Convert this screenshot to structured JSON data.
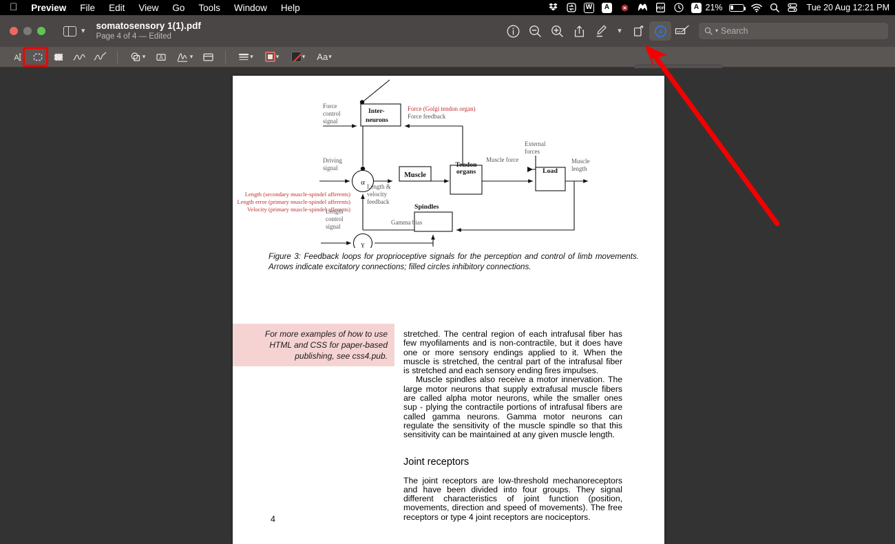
{
  "menubar": {
    "apple_icon": "apple-logo",
    "items": [
      {
        "label": "Preview",
        "bold": true
      },
      {
        "label": "File",
        "bold": false
      },
      {
        "label": "Edit",
        "bold": false
      },
      {
        "label": "View",
        "bold": false
      },
      {
        "label": "Go",
        "bold": false
      },
      {
        "label": "Tools",
        "bold": false
      },
      {
        "label": "Window",
        "bold": false
      },
      {
        "label": "Help",
        "bold": false
      }
    ],
    "status_icons": [
      "dropbox-icon",
      "sync-arrow-icon",
      "word-w-icon",
      "adobe-a-icon",
      "record-dot-icon",
      "malwarebytes-m-icon",
      "pdf-icon",
      "clock-history-icon",
      "text-input-a-icon"
    ],
    "battery_percent": "21%",
    "wifi_icon": "wifi-icon",
    "spotlight_icon": "search-icon",
    "controlcenter_icon": "control-center-icon",
    "clock": "Tue 20 Aug  12:21 PM"
  },
  "window": {
    "title": "somatosensory 1(1).pdf",
    "subtitle": "Page 4 of 4 — Edited",
    "traffic_lights": [
      "close-button",
      "minimize-button",
      "zoom-button"
    ],
    "sidebar_toggle": "sidebar-toggle-button",
    "toolbar": [
      {
        "name": "info-button",
        "icon": "info-circle-icon"
      },
      {
        "name": "zoom-out-button",
        "icon": "magnifier-minus-icon"
      },
      {
        "name": "zoom-in-button",
        "icon": "magnifier-plus-icon"
      },
      {
        "name": "share-button",
        "icon": "share-up-arrow-icon"
      },
      {
        "name": "markup-button",
        "icon": "markup-pen-icon"
      },
      {
        "name": "markup-dropdown",
        "icon": "chevron-down-icon"
      },
      {
        "name": "rotate-button",
        "icon": "rotate-page-icon"
      },
      {
        "name": "annotate-button",
        "icon": "circle-a-icon",
        "active": true
      },
      {
        "name": "signature-button",
        "icon": "signature-pad-icon"
      }
    ],
    "search_placeholder": "Search"
  },
  "markup_toolbar": {
    "tools": [
      {
        "name": "text-selection-tool",
        "icon": "text-cursor-icon",
        "selected": false
      },
      {
        "name": "rectangular-selection-tool",
        "icon": "dashed-rectangle-icon",
        "selected": true
      },
      {
        "name": "instant-alpha-tool",
        "icon": "filled-dashed-square-icon",
        "selected": false
      },
      {
        "name": "sketch-tool",
        "icon": "squiggle-line-icon",
        "selected": false
      },
      {
        "name": "draw-tool",
        "icon": "pen-squiggle-icon",
        "selected": false
      },
      {
        "name": "shapes-tool",
        "icon": "shapes-icon",
        "selected": false,
        "has_dropdown": true
      },
      {
        "name": "text-tool",
        "icon": "boxed-a-icon",
        "selected": false
      },
      {
        "name": "sign-tool",
        "icon": "signature-icon",
        "selected": false,
        "has_dropdown": true
      },
      {
        "name": "note-tool",
        "icon": "sticky-note-icon",
        "selected": false
      }
    ],
    "styles": [
      {
        "name": "border-style-dropdown",
        "icon": "line-weight-icon"
      },
      {
        "name": "border-color-dropdown",
        "icon": "red-square-swatch-icon"
      },
      {
        "name": "fill-color-dropdown",
        "icon": "no-fill-swatch-icon"
      },
      {
        "name": "font-style-dropdown",
        "label": "Aa"
      }
    ]
  },
  "annotation": {
    "highlight_box": "red-rectangle-highlight",
    "arrow": "red-arrow-pointer",
    "arrow_color": "#f40000"
  },
  "document": {
    "page_number": "4",
    "figure": {
      "caption": "Figure 3:  Feedback loops for proprioceptive signals for the perception and control of limb movements. Arrows indicate excitatory connections; filled circles inhibitory connections.",
      "boxes": [
        {
          "label": "Inter-neurons",
          "line1": "Inter-",
          "line2": "neurons"
        },
        {
          "label": "Muscle"
        },
        {
          "label": "Tendon organs",
          "line1": "Tendon",
          "line2": "organs"
        },
        {
          "label": "Load"
        },
        {
          "label": "Spindles"
        }
      ],
      "nodes": [
        {
          "label": "α",
          "type": "summing-junction"
        },
        {
          "label": "γ",
          "type": "summing-junction"
        }
      ],
      "gray_labels": [
        "Force control signal",
        "Force feedback",
        "Driving signal",
        "External forces",
        "Muscle force",
        "Muscle length",
        "Length & velocity feedback",
        "Length control signal",
        "Gamma bias",
        "Spindles"
      ],
      "red_labels": [
        "Force (Golgi tendon organ)",
        "Length (secondary muscle-spindel afferents)",
        "Length error (primary muscle-spindel afferents)",
        "Velocity (primary muscle-spindel afferents)"
      ],
      "red_label_color": "#c32d2d"
    },
    "callout": {
      "text": "For more examples of how to use HTML and CSS for paper-based publishing, see css4.pub.",
      "bg_color": "#f6d3d3"
    },
    "body": {
      "paragraphs": [
        "stretched. The central region of each intrafusal fiber has few myofilaments and is non-contractile, but it does have one or more sensory endings applied to it. When the muscle is stretched, the central part of the intrafusal fiber is stretched and each sensory ending fires impulses.",
        "Muscle spindles also receive a motor innervation. The large motor neurons that supply extrafusal muscle fibers are called alpha motor neurons, while the smaller ones sup - plying the contractile portions of intrafusal fibers are called gamma neurons. Gamma motor neurons can regulate the sensitivity of the muscle spindle so that this sensitivity can be maintained at any given muscle length."
      ],
      "section_heading": "Joint receptors",
      "section_paragraph": "The joint receptors are low-threshold mechanoreceptors and have been divided into four groups. They signal different characteristics of joint function (position, movements, direction and speed of movements). The free receptors or type 4 joint receptors are nociceptors."
    }
  }
}
